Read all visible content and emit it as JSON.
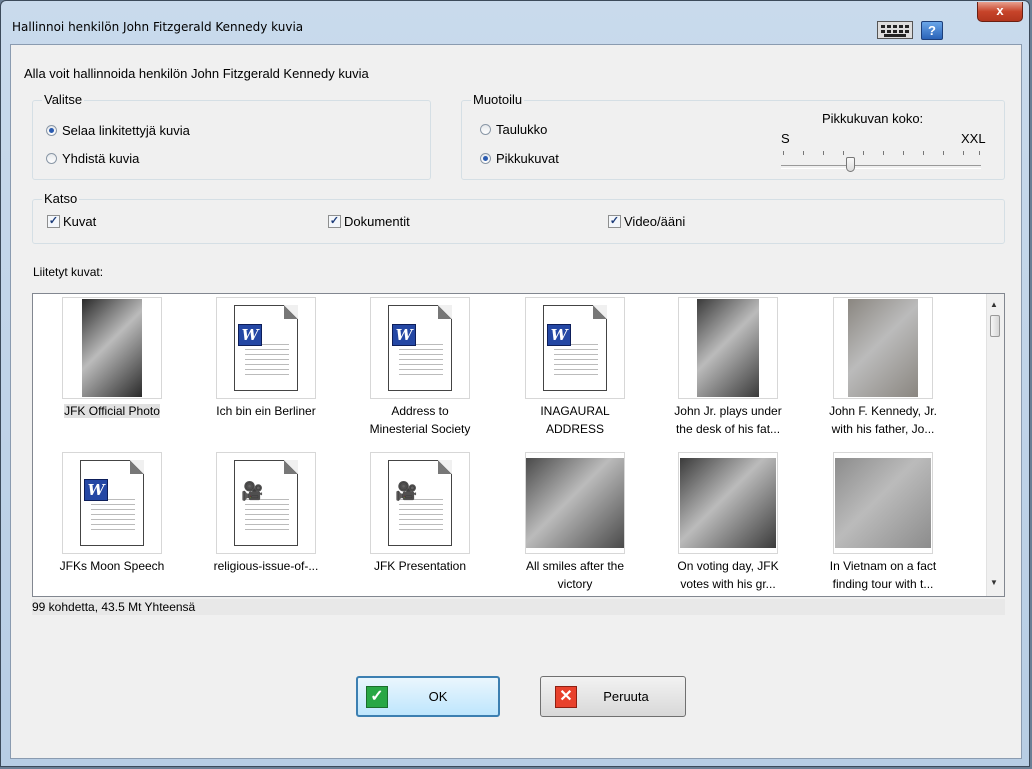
{
  "window": {
    "title": "Hallinnoi henkilön John Fitzgerald Kennedy kuvia",
    "close_label": "x",
    "help_label": "?"
  },
  "subtitle": "Alla voit hallinnoida henkilön John Fitzgerald Kennedy kuvia",
  "valitse": {
    "legend": "Valitse",
    "options": [
      {
        "label": "Selaa linkitettyjä kuvia",
        "checked": true
      },
      {
        "label": "Yhdistä kuvia",
        "checked": false
      }
    ]
  },
  "muotoilu": {
    "legend": "Muotoilu",
    "options": [
      {
        "label": "Taulukko",
        "checked": false
      },
      {
        "label": "Pikkukuvat",
        "checked": true
      }
    ],
    "slider": {
      "label": "Pikkukuvan koko:",
      "min_label": "S",
      "max_label": "XXL",
      "value_fraction": 0.35
    }
  },
  "katso": {
    "legend": "Katso",
    "checks": [
      {
        "label": "Kuvat",
        "checked": true
      },
      {
        "label": "Dokumentit",
        "checked": true
      },
      {
        "label": "Video/ääni",
        "checked": true
      }
    ]
  },
  "gallery": {
    "label": "Liitetyt kuvat:",
    "items": [
      {
        "kind": "photo",
        "line1": "JFK Official Photo",
        "line2": "",
        "selected": true
      },
      {
        "kind": "word",
        "line1": "Ich bin ein Berliner",
        "line2": ""
      },
      {
        "kind": "word",
        "line1": "Address to",
        "line2": "Minesterial Society"
      },
      {
        "kind": "word",
        "line1": "INAGAURAL",
        "line2": "ADDRESS"
      },
      {
        "kind": "photo",
        "line1": "John Jr. plays under",
        "line2": "the desk of his fat..."
      },
      {
        "kind": "photo",
        "line1": "John F. Kennedy, Jr.",
        "line2": "with his father, Jo..."
      },
      {
        "kind": "word",
        "line1": "JFKs Moon Speech",
        "line2": ""
      },
      {
        "kind": "video",
        "line1": "religious-issue-of-...",
        "line2": ""
      },
      {
        "kind": "video",
        "line1": "JFK Presentation",
        "line2": ""
      },
      {
        "kind": "photo",
        "line1": "All smiles after the",
        "line2": "victory"
      },
      {
        "kind": "photo",
        "line1": "On voting day, JFK",
        "line2": "votes with his gr..."
      },
      {
        "kind": "photo",
        "line1": "In Vietnam on a fact",
        "line2": "finding tour with t..."
      }
    ]
  },
  "status": "99 kohdetta, 43.5 Mt Yhteensä",
  "buttons": {
    "ok": "OK",
    "cancel": "Peruuta"
  },
  "icons": {
    "ok": "check-icon",
    "cancel": "x-icon",
    "keyboard": "keyboard-icon",
    "help": "help-icon"
  },
  "colors": {
    "ok_icon": "#28a745",
    "cancel_icon": "#e8412c",
    "radio_dot": "#2a5bb0"
  }
}
